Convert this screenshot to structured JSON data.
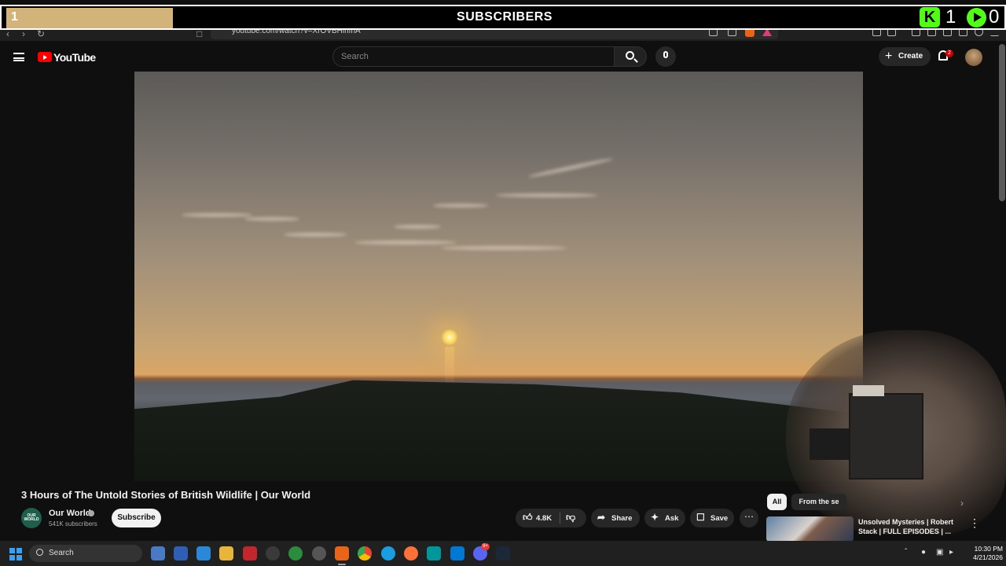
{
  "overlay": {
    "goal_count": "1",
    "goal_title": "SUBSCRIBERS",
    "kick_count": "1",
    "play_count": "0",
    "accent_color": "#53fc18"
  },
  "browser": {
    "url": "youtube.com/watch?v=XrOVBHinfhA"
  },
  "header": {
    "logo_text": "YouTube",
    "search_placeholder": "Search",
    "create_label": "Create",
    "notification_count": "2"
  },
  "video": {
    "title": "3 Hours of The Untold Stories of British Wildlife | Our World",
    "channel": {
      "name": "Our World",
      "avatar_text": "OUR WORLD",
      "subscribers": "541K subscribers",
      "subscribe_label": "Subscribe"
    },
    "actions": {
      "likes": "4.8K",
      "share": "Share",
      "ask": "Ask",
      "save": "Save"
    }
  },
  "sidebar": {
    "chips": [
      "All",
      "From the se"
    ],
    "recommendation": {
      "title": "Unsolved Mysteries | Robert Stack | FULL EPISODES | ..."
    }
  },
  "taskbar": {
    "search_label": "Search",
    "discord_badge": "9+",
    "time": "10:30 PM",
    "date": "4/21/2026"
  },
  "colors": {
    "background": "#0f0f0f",
    "youtube_red": "#ff0000",
    "pill": "#272727"
  }
}
